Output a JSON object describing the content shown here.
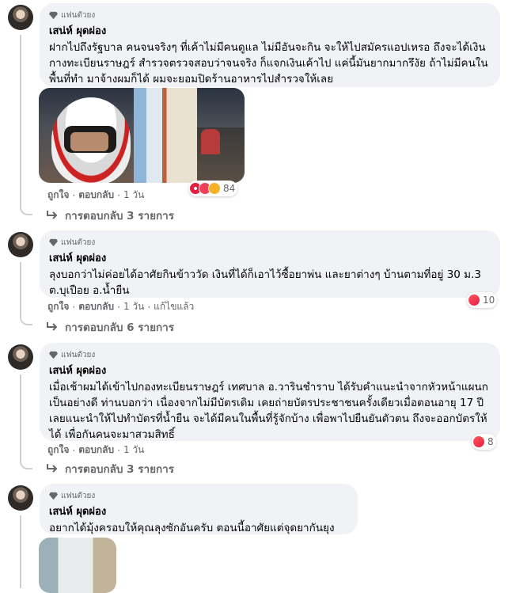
{
  "badge_label": "แฟนตัวยง",
  "comments": [
    {
      "author": "เสน่ห์ ผุดผ่อง",
      "text": "ฝากไปถึงรัฐบาล คนจนจริงๆ ที่เค้าไม่มีคนดูแล ไม่มีอันจะกิน จะให้ไปสมัครแอปเหรอ ถึงจะได้เงิน กางทะเบียนราษฎร์ สำรวจตรวจสอบว่าจนจริง ก็แจกเงินเค้าไป แค่นี้มันยากมากรึงัย ถ้าไม่มีคนในพื้นที่ทำ มาจ้างผมก็ได้ ผมจะยอมปิดร้านอาหารไปสำรวจให้เลย",
      "like": "ถูกใจ",
      "reply": "ตอบกลับ",
      "time": "1 วัน",
      "edited": "",
      "reaction_count": "84",
      "replies": "การตอบกลับ 3 รายการ"
    },
    {
      "author": "เสน่ห์ ผุดผ่อง",
      "text": "ลุงบอกว่าไม่ค่อยได้อาศัยกินข้าววัด เงินที่ได้ก็เอาไว้ซื้อยาพ่น และยาต่างๆ บ้านตามที่อยู่ 30 ม.3 ต.บุเปือย อ.น้ำยืน",
      "like": "ถูกใจ",
      "reply": "ตอบกลับ",
      "time": "1 วัน",
      "edited": "แก้ไขแล้ว",
      "reaction_count": "10",
      "replies": "การตอบกลับ 6 รายการ"
    },
    {
      "author": "เสน่ห์ ผุดผ่อง",
      "text": "เมื่อเช้าผมได้เข้าไปกองทะเบียนราษฎร์ เทศบาล อ.วารินชำราบ ได้รับคำแนะนำจากหัวหน้าแผนกเป็นอย่างดี ท่านบอกว่า เนื่องจากไม่มีบัตรเดิม เคยถ่ายบัตรประชาชนครั้งเดียวเมื่อตอนอายุ 17 ปี เลยแนะนำให้ไปทำบัตรที่น้ำยืน จะได้มีคนในพื้นที่รู้จักบ้าง เพื่อพาไปยืนยันตัวตน ถึงจะออกบัตรให้ได้ เพื่อกันคนจะมาสวมสิทธิ์",
      "like": "ถูกใจ",
      "reply": "ตอบกลับ",
      "time": "1 วัน",
      "edited": "",
      "reaction_count": "8",
      "replies": "การตอบกลับ 3 รายการ"
    },
    {
      "author": "เสน่ห์ ผุดผ่อง",
      "text": "อยากได้มุ้งครอบให้คุณลุงซักอันครับ ตอนนี้อาศัยแต่จุดยากันยุง"
    }
  ]
}
